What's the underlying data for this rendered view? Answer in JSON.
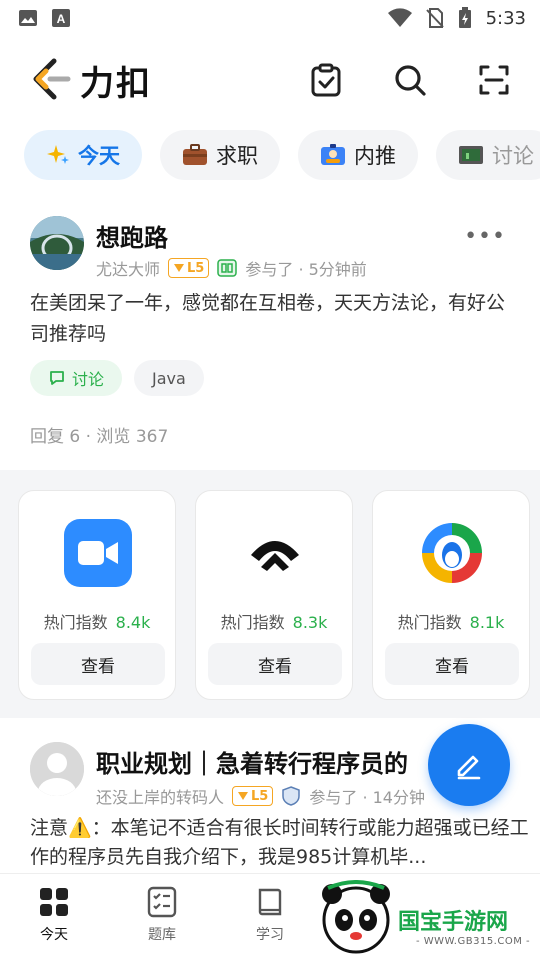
{
  "statusbar": {
    "time": "5:33"
  },
  "app": {
    "logo_text": "力扣"
  },
  "tabs": [
    {
      "label": "今天",
      "active": true
    },
    {
      "label": "求职",
      "active": false
    },
    {
      "label": "内推",
      "active": false
    },
    {
      "label": "讨论",
      "active": false
    }
  ],
  "post1": {
    "author": "想跑路",
    "role": "尤达大师",
    "level": "L5",
    "activity": "参与了 · 5分钟前",
    "content": "在美团呆了一年，感觉都在互相卷，天天方法论，有好公司推荐吗",
    "tags": [
      "讨论",
      "Java"
    ],
    "stats": "回复 6  ·  浏览 367",
    "more": "•••"
  },
  "companies": [
    {
      "heat_label": "热门指数",
      "heat_value": "8.4k",
      "button": "查看",
      "icon": "zoom-icon"
    },
    {
      "heat_label": "热门指数",
      "heat_value": "8.3k",
      "button": "查看",
      "icon": "nio-icon"
    },
    {
      "heat_label": "热门指数",
      "heat_value": "8.1k",
      "button": "查看",
      "icon": "tencent-icon"
    }
  ],
  "post2": {
    "title": "职业规划｜急着转行程序员的",
    "role": "还没上岸的转码人",
    "level": "L5",
    "activity": "参与了 · 14分钟",
    "content": "注意⚠️：本笔记不适合有很长时间转行或能力超强或已经工作的程序员先自我介绍下，我是985计算机毕..."
  },
  "nav": [
    {
      "label": "今天",
      "active": true
    },
    {
      "label": "题库",
      "active": false
    },
    {
      "label": "学习",
      "active": false
    }
  ],
  "watermark": {
    "text": "国宝手游网",
    "sub": "- WWW.GB315.COM -"
  },
  "colors": {
    "accent": "#1a7cf0",
    "green": "#2bb04c",
    "level": "#f5a623"
  }
}
